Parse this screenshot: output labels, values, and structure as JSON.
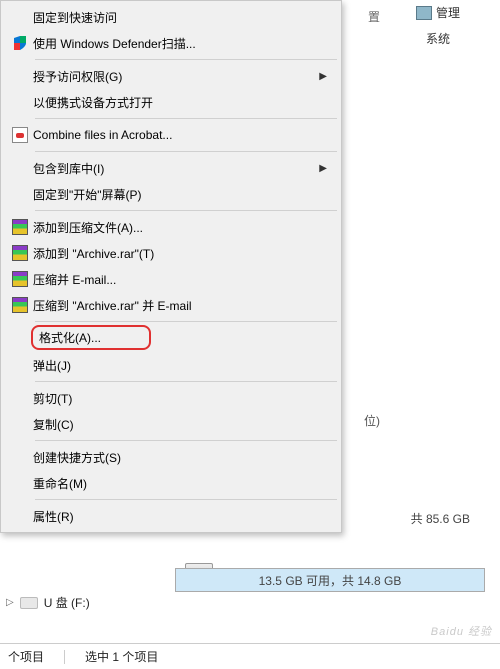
{
  "ribbon": {
    "settings_fragment": "置",
    "manage_label": "管理",
    "system_label": "系统"
  },
  "context_menu": {
    "pin_quick_access": "固定到快速访问",
    "defender_scan": "使用 Windows Defender扫描...",
    "grant_access": "授予访问权限(G)",
    "portable_device": "以便携式设备方式打开",
    "combine_acrobat": "Combine files in Acrobat...",
    "include_library": "包含到库中(I)",
    "pin_start": "固定到\"开始\"屏幕(P)",
    "add_archive": "添加到压缩文件(A)...",
    "add_archive_rar": "添加到 \"Archive.rar\"(T)",
    "compress_email": "压缩并 E-mail...",
    "compress_rar_email": "压缩到 \"Archive.rar\" 并 E-mail",
    "format": "格式化(A)...",
    "eject": "弹出(J)",
    "cut": "剪切(T)",
    "copy": "复制(C)",
    "create_shortcut": "创建快捷方式(S)",
    "rename": "重命名(M)",
    "properties": "属性(R)"
  },
  "background": {
    "wei_label": "位)",
    "disk_total_right": "共 85.6 GB",
    "disk_bar_text": "13.5 GB 可用，共 14.8 GB"
  },
  "tree": {
    "udisk_label": "U 盘 (F:)"
  },
  "status": {
    "items": "个项目",
    "selected": "选中 1 个项目"
  },
  "watermark": "Baidu 经验"
}
